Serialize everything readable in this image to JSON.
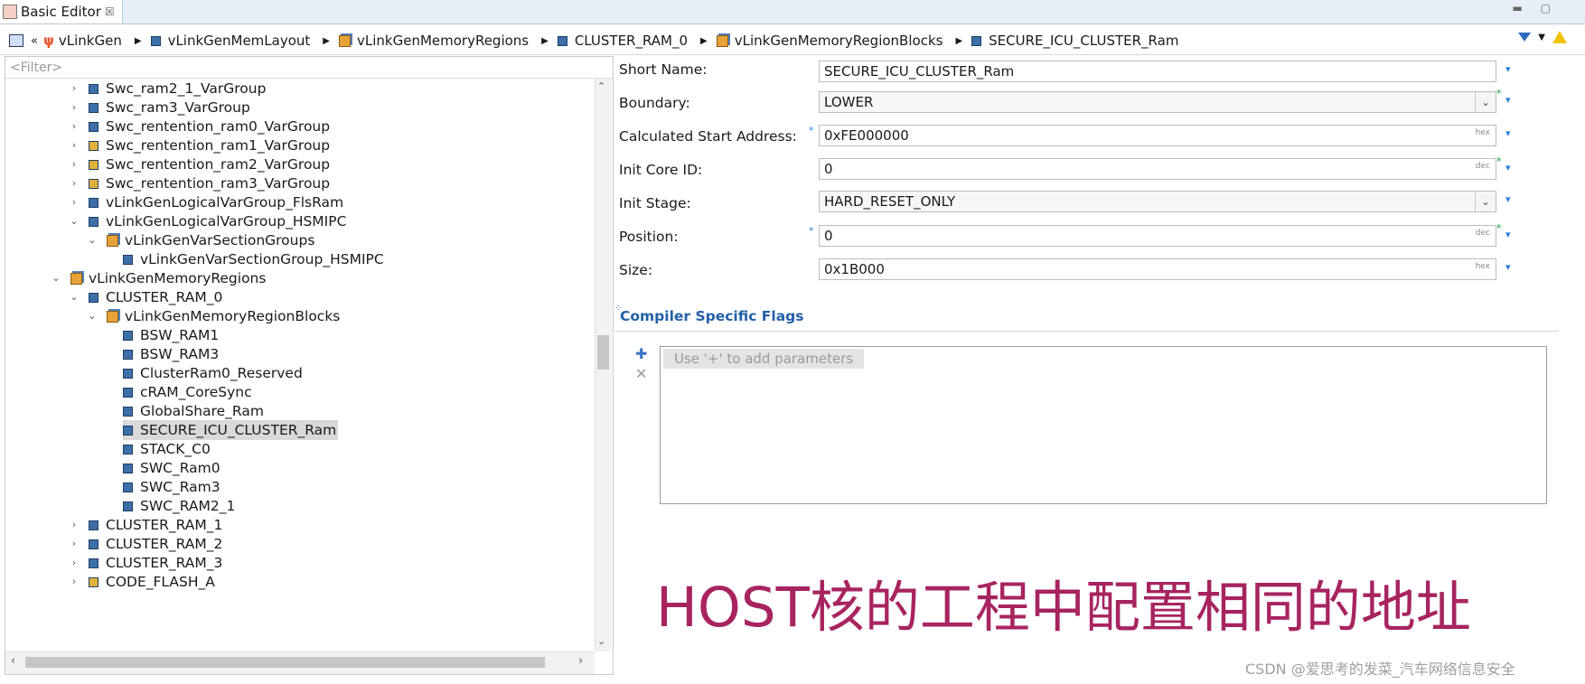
{
  "tab": {
    "title": "Basic Editor",
    "close": "☒"
  },
  "breadcrumb": [
    "vLinkGen",
    "vLinkGenMemLayout",
    "vLinkGenMemoryRegions",
    "CLUSTER_RAM_0",
    "vLinkGenMemoryRegionBlocks",
    "SECURE_ICU_CLUSTER_Ram"
  ],
  "tree": {
    "filter_placeholder": "<Filter>",
    "items": [
      {
        "label": "Swc_ram2_1_VarGroup"
      },
      {
        "label": "Swc_ram3_VarGroup"
      },
      {
        "label": "Swc_rentention_ram0_VarGroup"
      },
      {
        "label": "Swc_rentention_ram1_VarGroup"
      },
      {
        "label": "Swc_rentention_ram2_VarGroup"
      },
      {
        "label": "Swc_rentention_ram3_VarGroup"
      },
      {
        "label": "vLinkGenLogicalVarGroup_FlsRam"
      },
      {
        "label": "vLinkGenLogicalVarGroup_HSMIPC"
      },
      {
        "label": "vLinkGenVarSectionGroups"
      },
      {
        "label": "vLinkGenVarSectionGroup_HSMIPC"
      },
      {
        "label": "vLinkGenMemoryRegions"
      },
      {
        "label": "CLUSTER_RAM_0"
      },
      {
        "label": "vLinkGenMemoryRegionBlocks"
      },
      {
        "label": "BSW_RAM1"
      },
      {
        "label": "BSW_RAM3"
      },
      {
        "label": "ClusterRam0_Reserved"
      },
      {
        "label": "cRAM_CoreSync"
      },
      {
        "label": "GlobalShare_Ram"
      },
      {
        "label": "SECURE_ICU_CLUSTER_Ram"
      },
      {
        "label": "STACK_C0"
      },
      {
        "label": "SWC_Ram0"
      },
      {
        "label": "SWC_Ram3"
      },
      {
        "label": "SWC_RAM2_1"
      },
      {
        "label": "CLUSTER_RAM_1"
      },
      {
        "label": "CLUSTER_RAM_2"
      },
      {
        "label": "CLUSTER_RAM_3"
      },
      {
        "label": "CODE_FLASH_A"
      }
    ]
  },
  "form": {
    "short_name": {
      "label": "Short Name:",
      "value": "SECURE_ICU_CLUSTER_Ram"
    },
    "boundary": {
      "label": "Boundary:",
      "value": "LOWER"
    },
    "calc_start": {
      "label": "Calculated Start Address:",
      "value": "0xFE000000",
      "unit": "hex"
    },
    "init_core": {
      "label": "Init Core ID:",
      "value": "0",
      "unit": "dec"
    },
    "init_stage": {
      "label": "Init Stage:",
      "value": "HARD_RESET_ONLY"
    },
    "position": {
      "label": "Position:",
      "value": "0",
      "unit": "dec"
    },
    "size": {
      "label": "Size:",
      "value": "0x1B000",
      "unit": "hex"
    }
  },
  "compiler": {
    "title": "Compiler Specific Flags",
    "hint": "Use '+' to add parameters"
  },
  "overlay_text": "HOST核的工程中配置相同的地址",
  "watermark": "CSDN @爱思考的发菜_汽车网络信息安全"
}
